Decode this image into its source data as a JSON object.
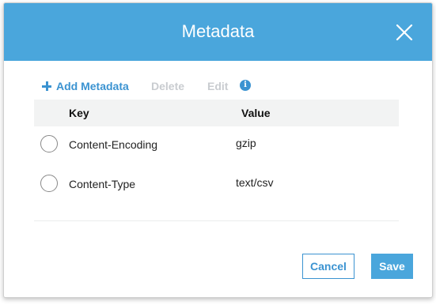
{
  "dialog": {
    "title": "Metadata",
    "header_color": "#4aa6dc",
    "close_icon": "close-icon"
  },
  "toolbar": {
    "add_label": "Add Metadata",
    "delete_label": "Delete",
    "edit_label": "Edit",
    "info_icon": "info-icon",
    "info_glyph": "i",
    "add_enabled": true,
    "delete_enabled": false,
    "edit_enabled": false,
    "accent_color": "#3b93d1",
    "disabled_color": "#c9ccd0"
  },
  "table": {
    "headers": {
      "key": "Key",
      "value": "Value"
    },
    "rows": [
      {
        "key": "Content-Encoding",
        "value": "gzip",
        "selected": false
      },
      {
        "key": "Content-Type",
        "value": "text/csv",
        "selected": false
      }
    ]
  },
  "footer": {
    "cancel_label": "Cancel",
    "save_label": "Save"
  }
}
